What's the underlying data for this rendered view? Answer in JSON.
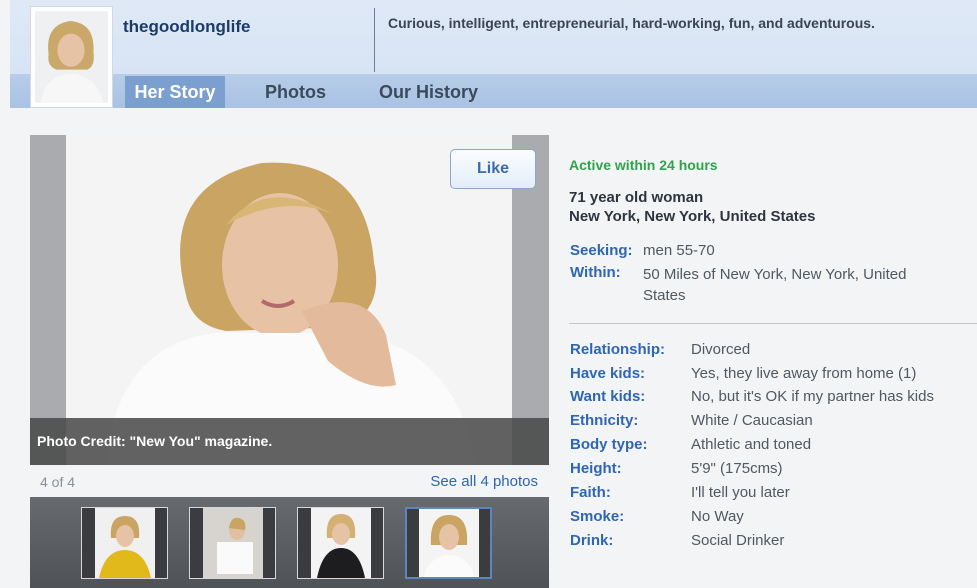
{
  "profile": {
    "username": "thegoodlonglife",
    "tagline": "Curious, intelligent, entrepreneurial, hard-working, fun, and adventurous."
  },
  "tabs": [
    "Her Story",
    "Photos",
    "Our History"
  ],
  "photo": {
    "like_label": "Like",
    "credit": "Photo Credit: \"New You\" magazine.",
    "counter": "4 of 4",
    "see_all": "See all 4 photos"
  },
  "info": {
    "activity": "Active within 24 hours",
    "age_line": "71 year old woman",
    "location_line": "New York, New York, United States",
    "seeking_label": "Seeking:",
    "seeking_value": "men 55-70",
    "within_label": "Within:",
    "within_value": "50 Miles of New York, New York, United States",
    "details": [
      {
        "label": "Relationship:",
        "value": "Divorced"
      },
      {
        "label": "Have kids:",
        "value": "Yes, they live away from home (1)"
      },
      {
        "label": "Want kids:",
        "value": "No, but it's OK if my partner has kids"
      },
      {
        "label": "Ethnicity:",
        "value": "White / Caucasian"
      },
      {
        "label": "Body type:",
        "value": "Athletic and toned"
      },
      {
        "label": "Height:",
        "value": "5'9\" (175cms)"
      },
      {
        "label": "Faith:",
        "value": "I'll tell you later"
      },
      {
        "label": "Smoke:",
        "value": "No Way"
      },
      {
        "label": "Drink:",
        "value": "Social Drinker"
      }
    ]
  },
  "colors": {
    "accent": "#2f66b3",
    "active_green": "#2fa34a",
    "tab_active": "#7ba0d0"
  },
  "icons": [
    "thumbs-up-icon"
  ]
}
